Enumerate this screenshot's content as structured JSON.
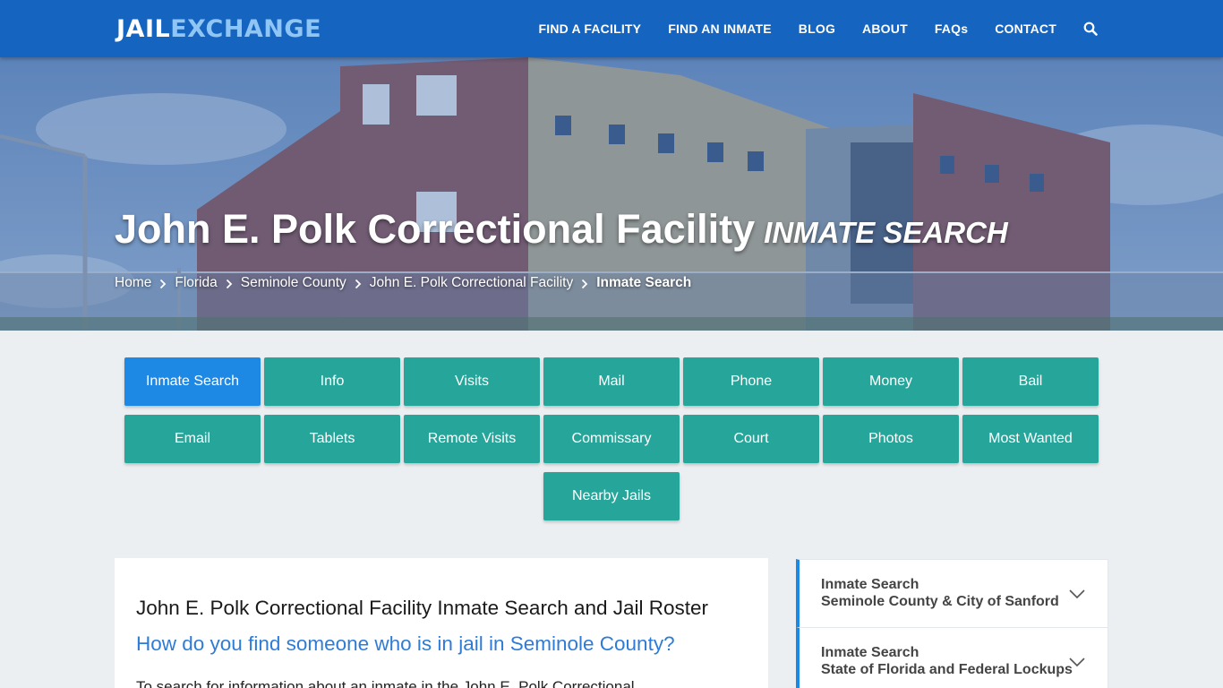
{
  "header": {
    "logo_part1": "JAIL",
    "logo_part2": "EXCHANGE",
    "nav": [
      "FIND A FACILITY",
      "FIND AN INMATE",
      "BLOG",
      "ABOUT",
      "FAQs",
      "CONTACT"
    ],
    "search_icon": "search-icon"
  },
  "hero": {
    "title": "John E. Polk Correctional Facility",
    "subtitle": "INMATE SEARCH",
    "breadcrumbs": [
      "Home",
      "Florida",
      "Seminole County",
      "John E. Polk Correctional Facility"
    ],
    "breadcrumb_current": "Inmate Search"
  },
  "buttons": [
    {
      "label": "Inmate Search",
      "active": true
    },
    {
      "label": "Info"
    },
    {
      "label": "Visits"
    },
    {
      "label": "Mail"
    },
    {
      "label": "Phone"
    },
    {
      "label": "Money"
    },
    {
      "label": "Bail"
    },
    {
      "label": "Email"
    },
    {
      "label": "Tablets"
    },
    {
      "label": "Remote Visits"
    },
    {
      "label": "Commissary"
    },
    {
      "label": "Court"
    },
    {
      "label": "Photos"
    },
    {
      "label": "Most Wanted"
    },
    {
      "label": "Nearby Jails"
    }
  ],
  "main": {
    "heading": "John E. Polk Correctional Facility Inmate Search and Jail Roster",
    "subheading": "How do you find someone who is in jail in Seminole County?",
    "intro": "To search for information about an inmate in the John E. Polk Correctional"
  },
  "sidebar": {
    "items": [
      {
        "line1": "Inmate Search",
        "line2": "Seminole County & City of Sanford"
      },
      {
        "line1": "Inmate Search",
        "line2": "State of Florida and Federal Lockups"
      }
    ]
  },
  "colors": {
    "header_blue": "#1565c0",
    "teal_button": "#26a69a",
    "active_button": "#1e88e5",
    "link_blue": "#2e7cd6"
  }
}
